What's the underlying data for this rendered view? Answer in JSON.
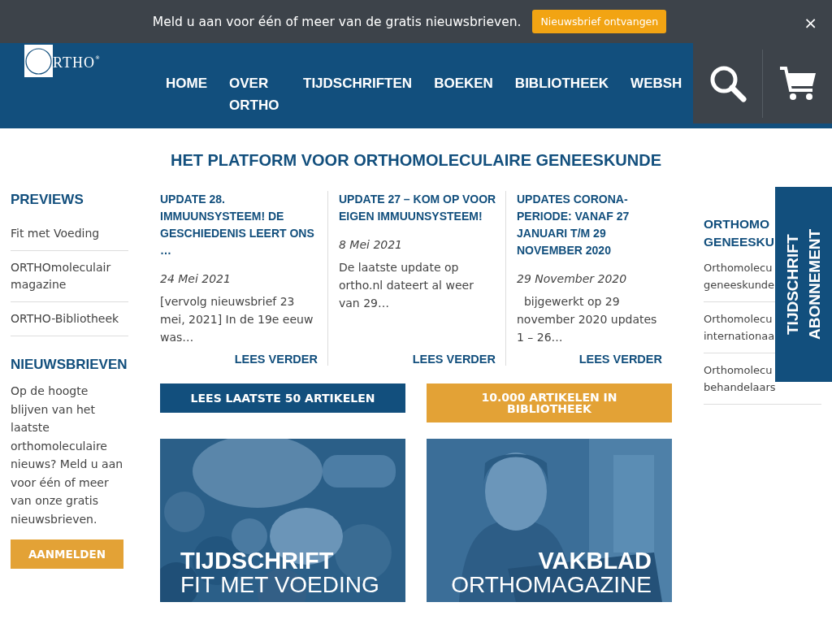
{
  "notice_bar": {
    "message": "Meld u aan voor één of meer van de gratis nieuwsbrieven.",
    "button": "Nieuwsbrief ontvangen",
    "close": "×"
  },
  "header": {
    "logo": {
      "text": "RTHO",
      "mark": "®"
    },
    "nav": [
      {
        "label": "HOME"
      },
      {
        "label": "OVER ORTHO"
      },
      {
        "label": "TIJDSCHRIFTEN"
      },
      {
        "label": "BOEKEN"
      },
      {
        "label": "BIBLIOTHEEK"
      },
      {
        "label": "WEBSH"
      }
    ]
  },
  "page_title": "HET PLATFORM VOOR ORTHOMOLECULAIRE GENEESKUNDE",
  "left_sidebar": {
    "previews_heading": "PREVIEWS",
    "previews": [
      "Fit met Voeding",
      "ORTHOmoleculair magazine",
      "ORTHO-Bibliotheek"
    ],
    "newsletter_heading": "NIEUWSBRIEVEN",
    "newsletter_text": "Op de hoogte blijven van het laatste orthomoleculaire nieuws? Meld u aan voor één of meer van onze gratis nieuwsbrieven.",
    "newsletter_button": "AANMELDEN"
  },
  "articles": [
    {
      "title": "UPDATE 28. IMMUUNSYSTEEM! DE GESCHIEDENIS LEERT ONS …",
      "date": "24 Mei 2021",
      "excerpt": "[vervolg nieuwsbrief 23 mei, 2021] In de 19e eeuw was…",
      "link": "LEES VERDER"
    },
    {
      "title": "UPDATE 27 – KOM OP VOOR EIGEN IMMUUNSYSTEEM!",
      "date": "8 Mei 2021",
      "excerpt": "De laatste update op ortho.nl dateert al weer van 29…",
      "link": "LEES VERDER"
    },
    {
      "title": "UPDATES CORONA-PERIODE: VANAF 27 JANUARI T/M 29 NOVEMBER 2020",
      "date": "29 November 2020",
      "excerpt": "  bijgewerkt op 29 november 2020 updates 1 – 26…",
      "link": "LEES VERDER"
    }
  ],
  "action_buttons": [
    {
      "label": "LEES LAATSTE 50 ARTIKELEN",
      "color": "#124f7d"
    },
    {
      "label": "10.000 ARTIKELEN IN BIBLIOTHEEK",
      "color": "#e3a236"
    }
  ],
  "promo_tiles": [
    {
      "kind": "picture",
      "title": "TIJDSCHRIFT",
      "subtitle": "FIT MET VOEDING"
    },
    {
      "kind": "picture",
      "title": "VAKBLAD",
      "subtitle": "ORTHOMAGAZINE"
    }
  ],
  "right_sidebar": {
    "heading": "ORTHOMO GENEESKU",
    "items": [
      "Orthomolecu geneeskunde",
      "Orthomolecu internationaa",
      "Orthomolecu behandelaars"
    ]
  },
  "side_tab": "TIJDSCHRIFT ABONNEMENT"
}
